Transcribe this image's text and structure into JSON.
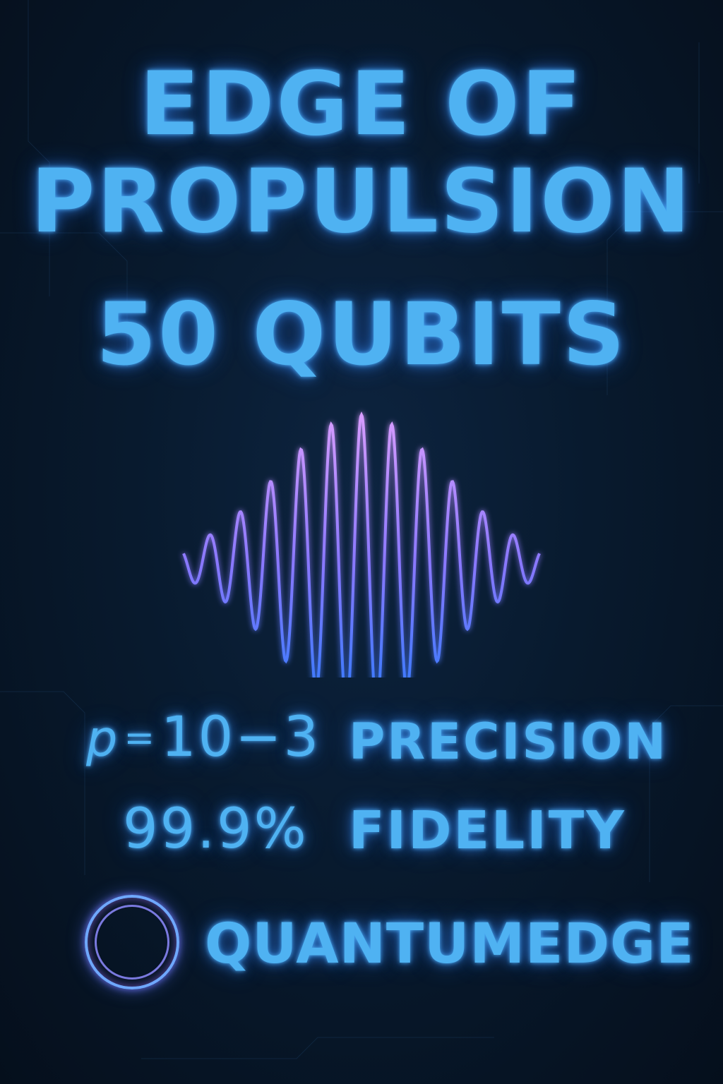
{
  "title": {
    "line1": "EDGE OF",
    "line2": "PROPULSION",
    "line3": "50 QUBITS"
  },
  "precision": {
    "variable": "p",
    "equals": "=",
    "value": "10−3",
    "label": "PRECISION"
  },
  "fidelity": {
    "value": "99.9%",
    "label": "FIDELITY"
  },
  "brand": {
    "name": "QUANTUMEDGE",
    "logo_icon": "ring-logo-icon"
  },
  "colors": {
    "background": "#081a2e",
    "neon_blue": "#4fb2f2",
    "neon_violet": "#b88cff",
    "wave_blue": "#3f7dff"
  }
}
